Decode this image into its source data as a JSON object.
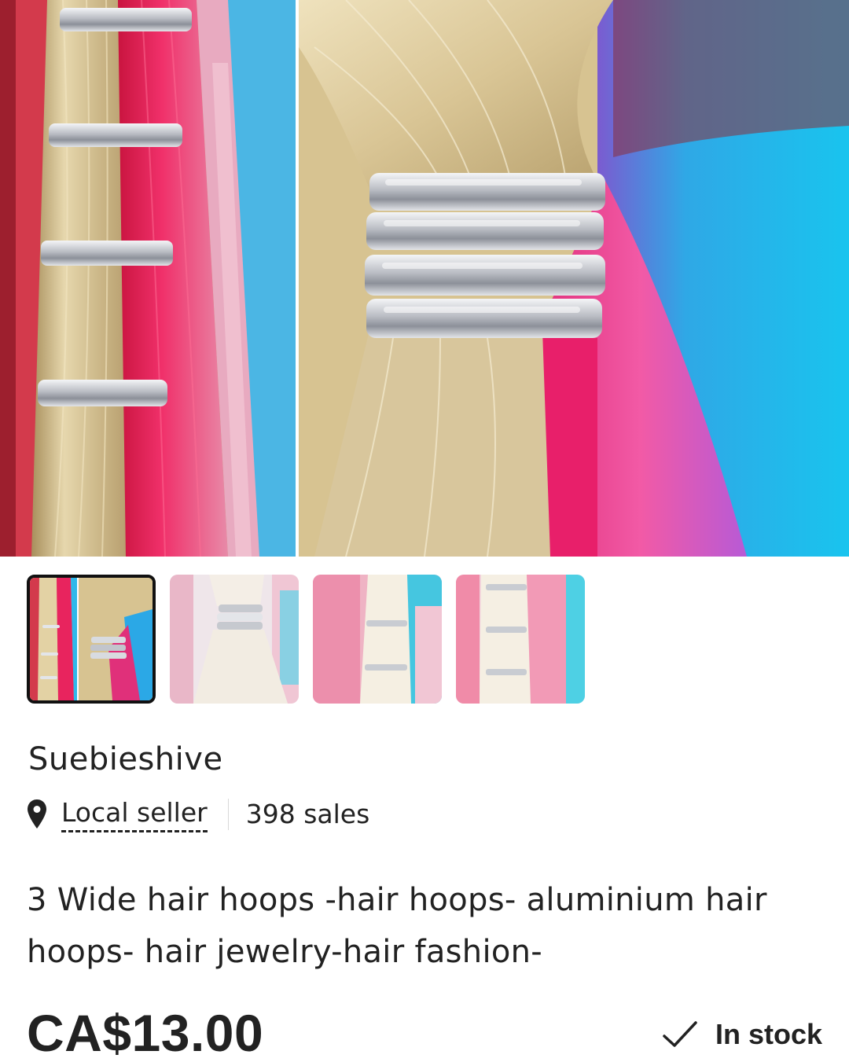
{
  "listing": {
    "shop_name": "Suebieshive",
    "location_label": "Local seller",
    "sales_label": "398 sales",
    "title": "3 Wide hair hoops -hair hoops- aluminium hair hoops- hair jewelry-hair fashion-",
    "price": "CA$13.00",
    "stock_status": "In stock"
  },
  "gallery": {
    "selected_index": 0,
    "thumbnail_count": 4
  },
  "icons": {
    "location": "map-pin-icon",
    "stock": "checkmark-icon"
  },
  "colors": {
    "text": "#222222",
    "hair_blonde": "#d9c79a",
    "hair_pink": "#e8245e",
    "hair_blue": "#2bb6e8",
    "metal": "#c9ccd2"
  }
}
